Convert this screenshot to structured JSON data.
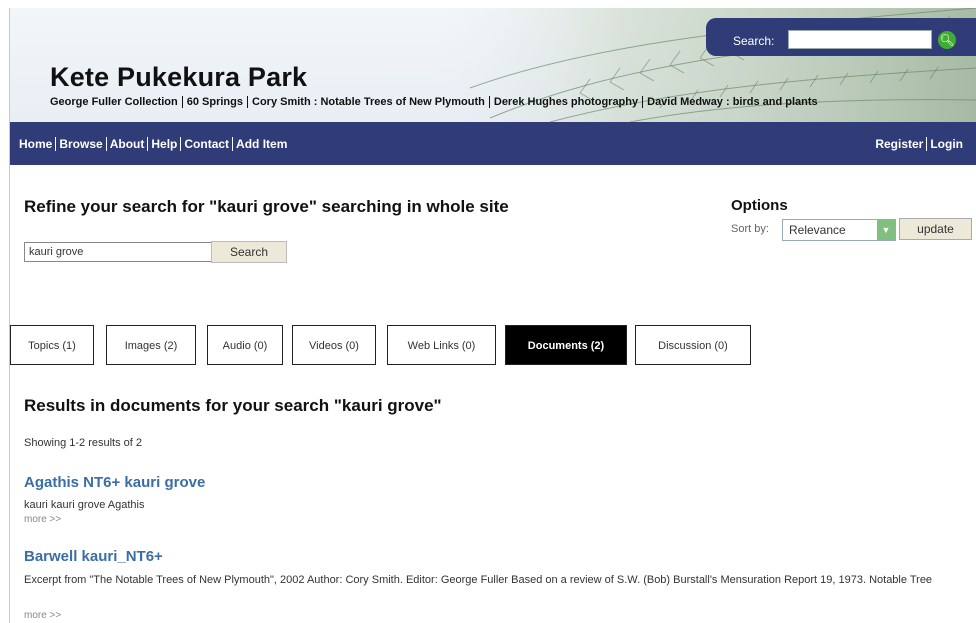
{
  "header": {
    "site_title": "Kete Pukekura Park",
    "search_label": "Search:",
    "search_value": "",
    "collections": [
      "George Fuller Collection",
      "60 Springs",
      "Cory Smith : Notable Trees of New Plymouth",
      "Derek Hughes photography",
      "David Medway : birds and plants"
    ]
  },
  "nav": {
    "left": [
      "Home",
      "Browse",
      "About",
      "Help",
      "Contact",
      "Add Item"
    ],
    "right": [
      "Register",
      "Login"
    ]
  },
  "refine": {
    "title": "Refine your search for \"kauri grove\" searching in whole site",
    "query": "kauri grove",
    "button": "Search"
  },
  "options": {
    "title": "Options",
    "sort_label": "Sort by:",
    "sort_value": "Relevance",
    "update": "update"
  },
  "tabs": [
    {
      "label": "Topics (1)",
      "active": false
    },
    {
      "label": "Images (2)",
      "active": false
    },
    {
      "label": "Audio (0)",
      "active": false
    },
    {
      "label": "Videos (0)",
      "active": false
    },
    {
      "label": "Web Links (0)",
      "active": false
    },
    {
      "label": "Documents (2)",
      "active": true
    },
    {
      "label": "Discussion (0)",
      "active": false
    }
  ],
  "results": {
    "title": "Results in documents for your search \"kauri grove\"",
    "showing": "Showing 1-2 results of 2",
    "items": [
      {
        "title": "Agathis NT6+ kauri grove",
        "desc": "kauri kauri grove Agathis",
        "more": "more >>"
      },
      {
        "title": "Barwell kauri_NT6+",
        "desc": "Excerpt from \"The Notable Trees of New Plymouth\", 2002 Author: Cory Smith. Editor: George Fuller Based on a review of S.W. (Bob) Burstall's Mensuration Report 19, 1973. Notable Tree",
        "more": "more >>"
      }
    ]
  }
}
